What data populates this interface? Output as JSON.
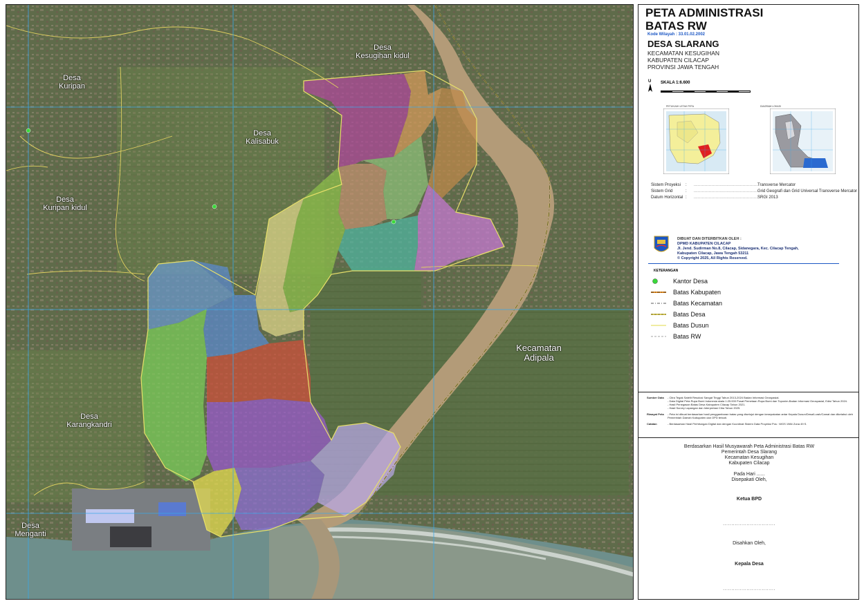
{
  "map": {
    "places": [
      {
        "id": "kesugihan-kidul",
        "text": "Desa\nKesugihan kidul"
      },
      {
        "id": "kuripan",
        "text": "Desa\nKuripan"
      },
      {
        "id": "kalisabuk",
        "text": "Desa\nKalisabuk"
      },
      {
        "id": "kuripan-kidul",
        "text": "Desa\nKuripan kidul"
      },
      {
        "id": "karangkandri",
        "text": "Desa\nKarangkandri"
      },
      {
        "id": "menganti",
        "text": "Desa\nMenganti"
      },
      {
        "id": "adipala",
        "text": "Kecamatan\nAdipala"
      }
    ],
    "colors": {
      "rw1": "#b0489c",
      "rw2": "#c98a5a",
      "rw3": "#c08a4a",
      "rw4": "#a8c278",
      "rw5": "#d69b5a",
      "rw6": "#4fb7a2",
      "rw7": "#d67be0",
      "rw8": "#8ec24a",
      "rw9": "#e0d88a",
      "rw10": "#5b8fd0",
      "rw11": "#4a86d6",
      "rw12": "#7cd05a",
      "rw13": "#d0503a",
      "rw14": "#9a5ad0",
      "rw15": "#e8e050",
      "rw16": "#8e6ed8",
      "rw17": "#b9a8e8",
      "river": "#b09a78",
      "sea": "#6a8c8a",
      "grid": "#3aa8e8",
      "kantor": "#3ad83a"
    }
  },
  "panel": {
    "title": "PETA ADMINISTRASI\nBATAS RW",
    "kode": "Kode Wilayah : 33.01.02.2002",
    "desa": "DESA SLARANG",
    "kecamatan": "KECAMATAN KESUGIHAN",
    "kabupaten": "KABUPATEN CILACAP",
    "provinsi": "PROVINSI JAWA TENGAH",
    "north": "U",
    "skala": "SKALA 1:6.600",
    "inset_left_caption": "PETUNJUK LETAK PETA",
    "inset_right_caption": "DIAGRAM LOKASI",
    "proj": [
      {
        "k": "Sistem Proyeksi",
        "v": "Transverse Mercator"
      },
      {
        "k": "Sistem Grid",
        "v": "Grid Geografi dan Grid Universal Transverse Mercator"
      },
      {
        "k": "Datum Horizontal",
        "v": "SRGI 2013"
      }
    ],
    "publisher": {
      "label": "DIBUAT DAN DITERBITKAN OLEH :",
      "org": "DPMD KABUPATEN CILACAP",
      "address1": "Jl. Jend. Sudirman No.8, Cilacap, Sidanegara, Kec. Cilacap Tengah,",
      "address2": "Kabupaten Cilacap, Jawa Tengah 53211",
      "copyright": "© Copyright 2025, All Rights Reserved."
    },
    "legend_title": "KETERANGAN",
    "legend": [
      {
        "id": "kantor",
        "label": "Kantor Desa"
      },
      {
        "id": "kab",
        "label": "Batas Kabupaten"
      },
      {
        "id": "kec",
        "label": "Batas Kecamatan"
      },
      {
        "id": "desa",
        "label": "Batas Desa"
      },
      {
        "id": "dusun",
        "label": "Batas Dusun"
      },
      {
        "id": "rw",
        "label": "Batas RW"
      }
    ],
    "notes": [
      {
        "k": "Sumber Data",
        "v": "- Citra Tegak Satelit Resolusi Sangat Tinggi Tahun 2013-2024 Badan Informasi Geospasial.\n- Data Digital Peta Rupa Bumi Indonesia skala 1:25.000 Pusat Pemetaan Rupa Bumi dan Toponim-Badan Informasi Geospasial, Edisi Tahun 2024.\n- Hasil Penegasan Batas Desa Kabupaten Cilacap Tahun 2021.\n- Hasil Survey Lapangan dan Interpretasi Citra Tahun 2025."
      },
      {
        "k": "Riwayat Peta",
        "v": "- Peta ini dibuat berdasarkan hasil penggambaran batas yang disetujui dengan kesepakatan antar Kepala Dusun/Desa/Lurah/Camat dan diketahui oleh Pemerintah Daerah Kabupaten dan OPD terkait."
      },
      {
        "k": "Catatan",
        "v": "- Berdasarkan Hasil Perhitungan Digital dan dengan Koordinat Sistem Data Proyeksi Pos : WGS 1984 Zona 49 S."
      }
    ],
    "sign": {
      "intro1": "Berdasarkan Hasil Musyawarah Peta Administrasi Batas RW",
      "intro2": "Pemerintah Desa Slarang",
      "intro3": "Kecamatan Kesugihan",
      "intro4": "Kabupaten Cilacap",
      "hari": "Pada Hari ......",
      "disepakati": "Disepakati Oleh,",
      "ketua": "Ketua BPD",
      "dots1": "...............................",
      "disahkan": "Disahkan Oleh,",
      "kepala": "Kepala Desa",
      "dots2": "..............................."
    }
  }
}
